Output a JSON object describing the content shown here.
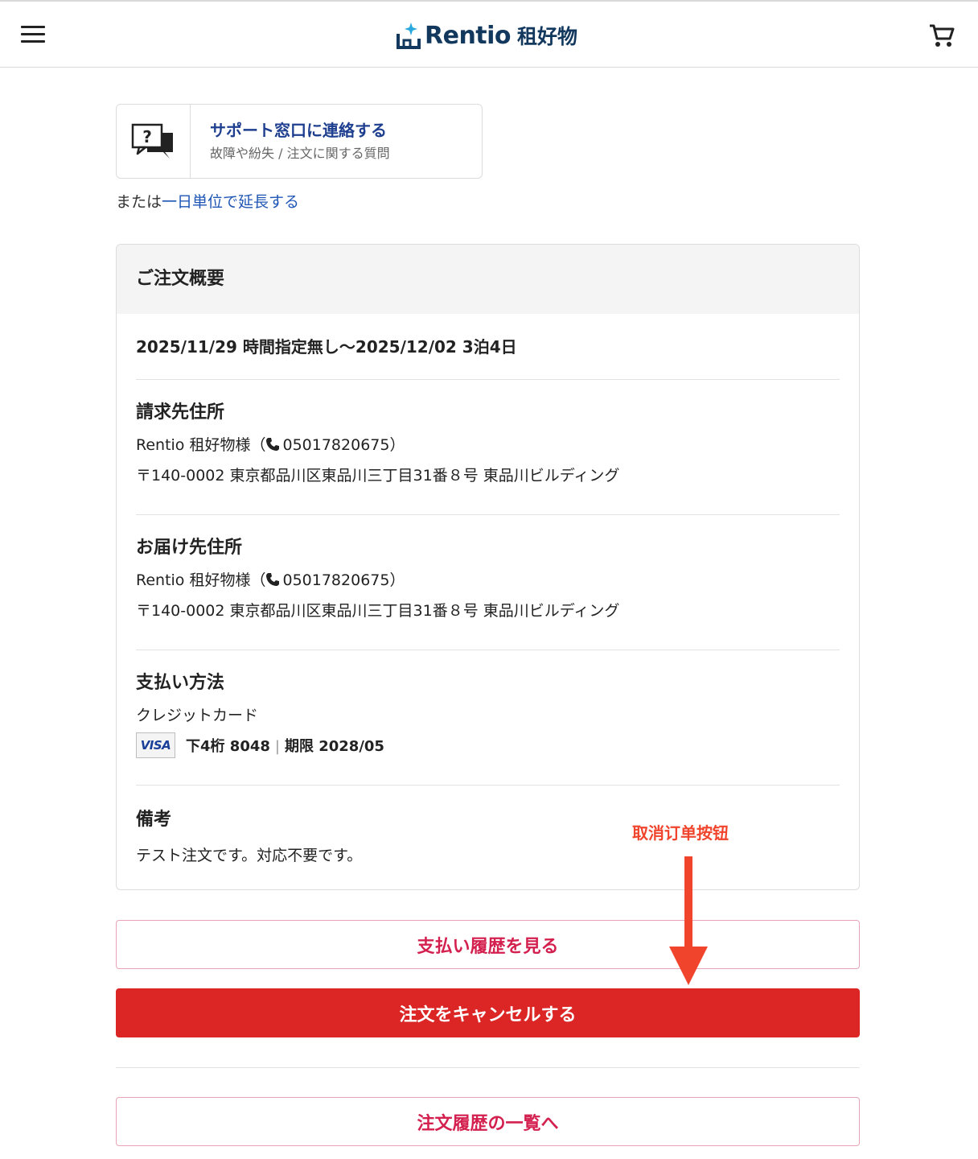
{
  "header": {
    "logo_text": "Rentio",
    "logo_sub": "租好物",
    "menu_icon": "hamburger-menu-icon",
    "cart_icon": "shopping-cart-icon",
    "brand_color": "#12385e"
  },
  "support": {
    "title": "サポート窓口に連絡する",
    "subtitle": "故障や紛失 / 注文に関する質問",
    "icon": "question-chat-icon"
  },
  "extend": {
    "prefix": "または",
    "link": "一日単位で延長する"
  },
  "summary": {
    "heading": "ご注文概要",
    "dates": "2025/11/29 時間指定無し〜2025/12/02 3泊4日",
    "billing": {
      "title": "請求先住所",
      "name_prefix": "Rentio 租好物様（",
      "phone": "05017820675",
      "name_suffix": "）",
      "address": "〒140-0002 東京都品川区東品川三丁目31番８号 東品川ビルディング"
    },
    "shipping": {
      "title": "お届け先住所",
      "name_prefix": "Rentio 租好物様（",
      "phone": "05017820675",
      "name_suffix": "）",
      "address": "〒140-0002 東京都品川区東品川三丁目31番８号 東品川ビルディング"
    },
    "payment": {
      "title": "支払い方法",
      "method": "クレジットカード",
      "card_brand": "VISA",
      "last4": "下4桁 8048",
      "separator": "|",
      "expiry": "期限 2028/05"
    },
    "note": {
      "title": "備考",
      "text": "テスト注文です。対応不要です。"
    }
  },
  "buttons": {
    "payment_history": "支払い履歴を見る",
    "cancel_order": "注文をキャンセルする",
    "order_history": "注文履歴の一覧へ"
  },
  "annotation": {
    "label": "取消订单按钮",
    "color": "#f0442c"
  },
  "colors": {
    "danger": "#dc2626",
    "accent_pink": "#d4204f",
    "link_blue": "#1e55b5"
  }
}
